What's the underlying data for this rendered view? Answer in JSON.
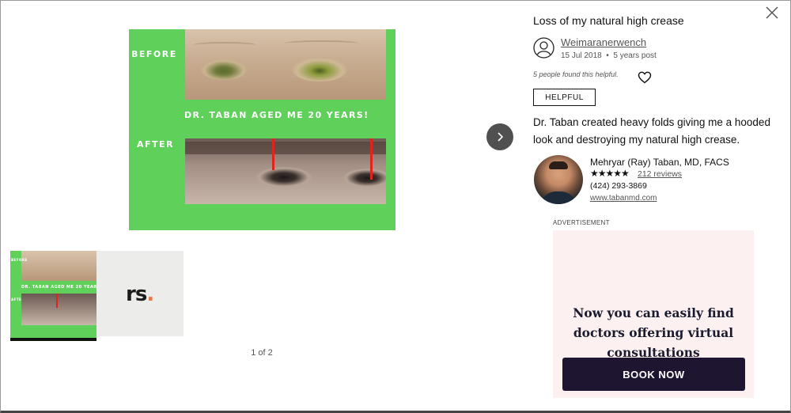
{
  "gallery": {
    "main_image": {
      "before_label": "BEFORE",
      "after_label": "AFTER",
      "headline": "DR. TABAN AGED ME 20 YEARS!"
    },
    "thumbnails": [
      {
        "type": "before-after",
        "before_label": "BEFORE",
        "headline": "DR. TABAN AGED ME 20 YEARS!",
        "after_label": "AFTER"
      },
      {
        "type": "logo",
        "logo_text": "rs",
        "logo_dot": ".",
        "logo_dot_color": "#e8774e"
      }
    ],
    "counter": "1 of 2",
    "next_icon": "chevron-right-icon",
    "close_icon": "close-icon",
    "accent_green": "#5fd15a"
  },
  "review": {
    "title": "Loss of my natural high crease",
    "username": "Weimaranerwench",
    "date": "15 Jul 2018",
    "separator": "•",
    "age": "5 years post",
    "helpful_count_text": "5 people found this helpful.",
    "helpful_button": "HELPFUL",
    "body": "Dr. Taban created heavy folds giving me a hooded look and destroying my natural high crease."
  },
  "doctor": {
    "name": "Mehryar (Ray) Taban, MD, FACS",
    "stars": "★★★★★",
    "rating": 5,
    "reviews": "212 reviews",
    "phone": "(424) 293-3869",
    "website": "www.tabanmd.com"
  },
  "ad": {
    "label": "ADVERTISEMENT",
    "headline": "Now you can easily find doctors offering virtual consultations",
    "button": "BOOK NOW",
    "background": "#fdf0f0",
    "button_color": "#1e1630"
  }
}
